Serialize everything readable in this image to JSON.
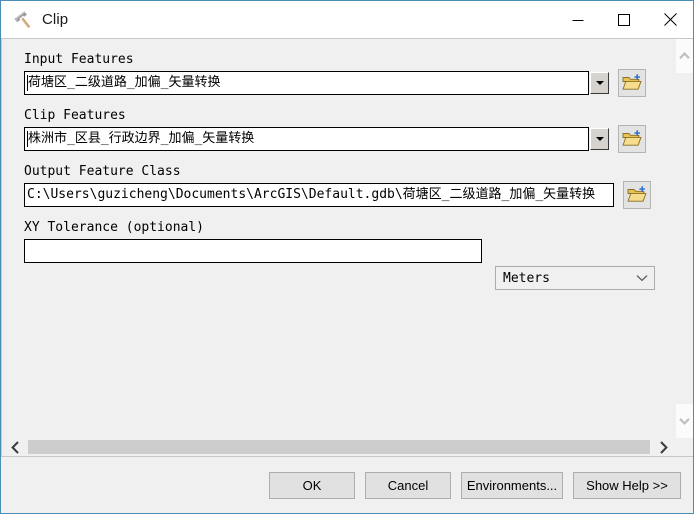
{
  "window": {
    "title": "Clip",
    "icon": "hammer-icon",
    "accent_border": "#4a8db7",
    "panel_background": "#f0f0f0",
    "controls": {
      "minimize": "minimize-icon",
      "maximize": "maximize-icon",
      "close": "close-icon"
    }
  },
  "form": {
    "input_features": {
      "label": "Input Features",
      "value": "荷塘区_二级道路_加偏_矢量转换",
      "browse_icon": "open-folder-add-icon",
      "dropdown_icon": "triangle-down-icon"
    },
    "clip_features": {
      "label": "Clip Features",
      "value": "株洲市_区县_行政边界_加偏_矢量转换",
      "browse_icon": "open-folder-add-icon",
      "dropdown_icon": "triangle-down-icon"
    },
    "output_feature_class": {
      "label": "Output Feature Class",
      "value": "C:\\Users\\guzicheng\\Documents\\ArcGIS\\Default.gdb\\荷塘区_二级道路_加偏_矢量转换",
      "browse_icon": "open-folder-add-icon"
    },
    "xy_tolerance": {
      "label": "XY Tolerance (optional)",
      "value": "",
      "units_value": "Meters",
      "units_icon": "chevron-down-icon"
    }
  },
  "scrollbars": {
    "vertical": {
      "up_icon": "chevron-up-icon",
      "down_icon": "chevron-down-icon"
    },
    "horizontal": {
      "left_icon": "chevron-left-icon",
      "right_icon": "chevron-right-icon"
    }
  },
  "footer": {
    "ok": "OK",
    "cancel": "Cancel",
    "environments": "Environments...",
    "show_help": "Show Help >>"
  }
}
